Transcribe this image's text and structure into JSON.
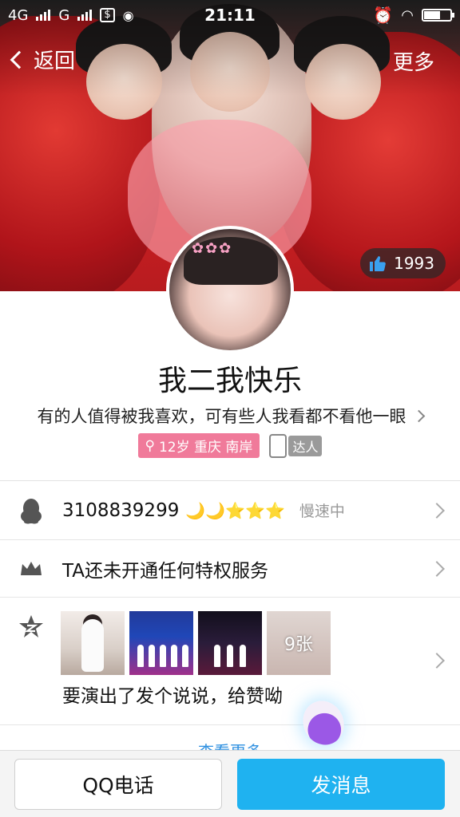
{
  "status_bar": {
    "network_left": "4G",
    "network_right": "G",
    "time": "21:11"
  },
  "nav": {
    "back_label": "返回",
    "more_label": "更多"
  },
  "likes": {
    "count": "1993"
  },
  "profile": {
    "nickname": "我二我快乐",
    "signature": "有的人值得被我喜欢，可有些人我看都不看他一眼",
    "info_tag": "12岁 重庆 南岸",
    "expert_tag": "达人"
  },
  "rows": {
    "qq": {
      "number": "3108839299",
      "levels": "🌙🌙⭐⭐⭐",
      "speed": "慢速中"
    },
    "privilege": {
      "text": "TA还未开通任何特权服务"
    },
    "qzone": {
      "photo_count": "9张",
      "post_text": "要演出了发个说说，给赞呦"
    }
  },
  "see_more": "查看更多",
  "bottom": {
    "call_label": "QQ电话",
    "message_label": "发消息"
  },
  "colors": {
    "accent_blue": "#1fb2f0",
    "tag_pink": "#f07a9a",
    "level_gold": "#f2b21c"
  }
}
